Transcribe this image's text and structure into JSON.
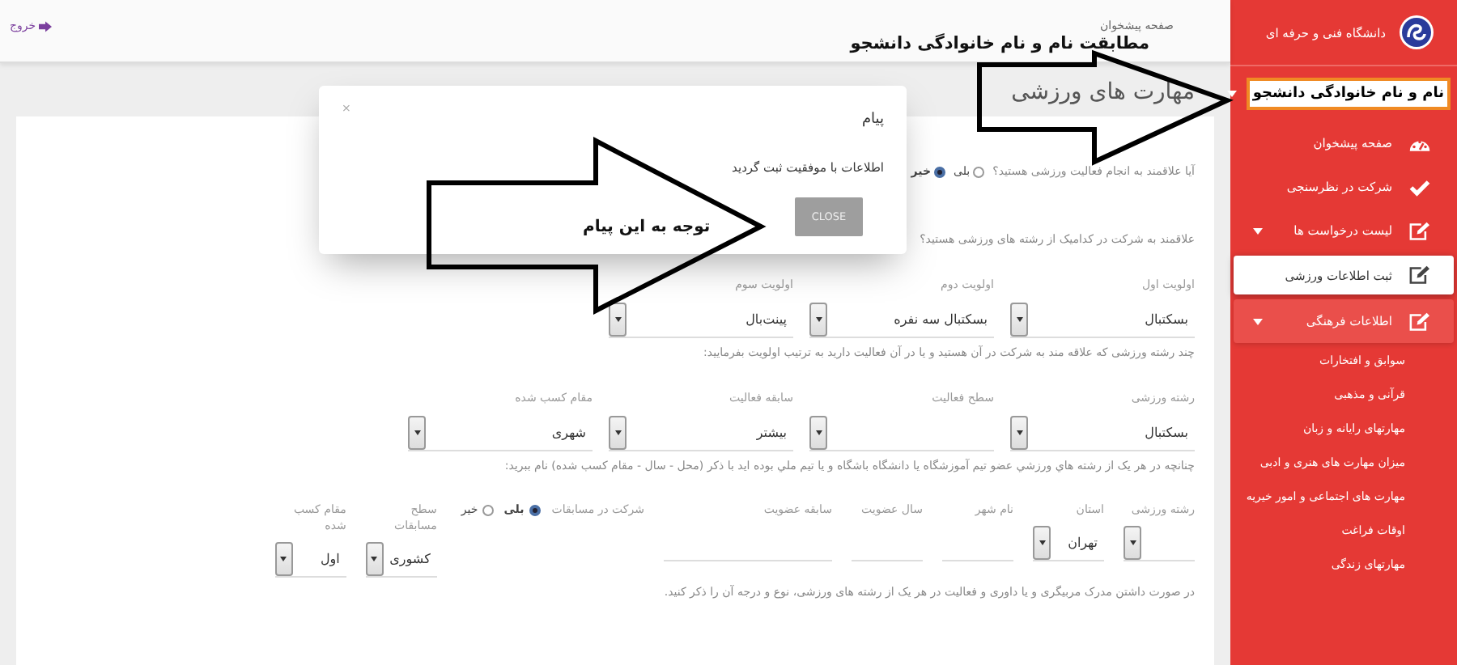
{
  "topbar": {
    "breadcrumb": "صفحه پیشخوان",
    "annotation": "مطابقت نام و نام خانوادگی دانشجو",
    "logout": "خروج"
  },
  "sidebar": {
    "brand": "دانشگاه فنی و حرفه ای",
    "user": {
      "name": "نام و نام خانوادگی دانشجو",
      "highlighted": true
    },
    "items": [
      {
        "label": "صفحه پیشخوان",
        "kind": "gauge",
        "selected": false,
        "highlighted": false
      },
      {
        "label": "شرکت در نظرسنجی",
        "kind": "check",
        "selected": false,
        "highlighted": false
      },
      {
        "label": "لیست درخواست ها",
        "kind": "edit",
        "selected": false,
        "highlighted": false,
        "expanded": true,
        "children": [
          {
            "label": "ثبت اطلاعات ورزشی",
            "kind": "edit",
            "selected": true,
            "highlighted": false
          }
        ]
      },
      {
        "label": "اطلاعات فرهنگی",
        "kind": "edit",
        "selected": false,
        "highlighted": true,
        "expanded": true,
        "children": [
          {
            "label": "سوابق و افتخارات",
            "selected": false,
            "highlighted": false
          },
          {
            "label": "قرآنی و مذهبی",
            "selected": false,
            "highlighted": false
          },
          {
            "label": "مهارتهای رایانه و زبان",
            "selected": false,
            "highlighted": false
          },
          {
            "label": "میزان مهارت های هنری و ادبی",
            "selected": false,
            "highlighted": false
          },
          {
            "label": "مهارت های اجتماعی و امور خیریه",
            "selected": false,
            "highlighted": false
          },
          {
            "label": "اوقات فراغت",
            "selected": false,
            "highlighted": false
          },
          {
            "label": "مهارتهای زندگی",
            "selected": false,
            "highlighted": false
          }
        ]
      }
    ]
  },
  "page": {
    "heading": "مهارت های ورزشی",
    "rows": [
      {
        "kind": "question",
        "text": "آیا علاقمند به انجام فعالیت ورزشی هستید؟",
        "options": [
          {
            "label": "بلی",
            "selected": false
          },
          {
            "label": "خیر",
            "selected": true
          }
        ]
      },
      {
        "kind": "note",
        "text": "علاقمند به شرکت در کدامیک از رشته های ورزشی هستید؟"
      },
      {
        "kind": "fields",
        "fields": [
          {
            "kind": "select",
            "label": "اولویت اول",
            "value": "بسکتبال"
          },
          {
            "kind": "select",
            "label": "اولویت دوم",
            "value": "بسکتبال سه نفره"
          },
          {
            "kind": "select",
            "label": "اولویت سوم",
            "value": "پینت‌بال"
          }
        ]
      },
      {
        "kind": "note",
        "text": "چند رشته ورزشی که علاقه مند به شرکت در آن هستید و یا در آن فعالیت دارید به ترتیب اولویت بفرمایید:"
      },
      {
        "kind": "fields",
        "fields": [
          {
            "kind": "select",
            "label": "رشته ورزشی",
            "value": "بسکتبال"
          },
          {
            "kind": "select",
            "label": "سطح فعالیت"
          },
          {
            "kind": "select",
            "label": "سابقه فعالیت",
            "value": "بیشتر"
          },
          {
            "kind": "select",
            "label": "مقام کسب شده",
            "value": "شهری"
          }
        ]
      },
      {
        "kind": "note",
        "text": "چنانچه در هر یک از رشته هاي ورزشي عضو تيم آموزشگاه يا دانشگاه باشگاه و يا تيم ملي بوده ايد با ذكر (محل - سال - مقام كسب شده) نام ببريد:"
      },
      {
        "kind": "compact",
        "fields": [
          {
            "kind": "select",
            "label": "رشته ورزشی"
          },
          {
            "kind": "select",
            "label": "استان",
            "value": "تهران"
          },
          {
            "kind": "text",
            "label": "نام شهر"
          },
          {
            "kind": "text",
            "label": "سال عضویت"
          },
          {
            "kind": "long-text",
            "label": "سابقه عضویت"
          },
          {
            "kind": "radio",
            "label": "شرکت در مسابقات",
            "options": [
              {
                "label": "بلی",
                "selected": true
              },
              {
                "label": "خیر",
                "selected": false
              }
            ]
          },
          {
            "kind": "select",
            "label": "سطح مسابقات",
            "value": "کشوری"
          },
          {
            "kind": "select",
            "label": "مقام کسب شده",
            "value": "اول"
          }
        ]
      },
      {
        "kind": "note",
        "text": "در صورت داشتن مدرک مربیگری و یا داوری و فعالیت در هر یک از رشته های ورزشی، نوع و درجه آن را ذکر کنید."
      }
    ]
  },
  "modal": {
    "title": "پیام",
    "close": "×",
    "message": "اطلاعات با موفقیت ثبت گردید",
    "button": "CLOSE"
  },
  "callout": {
    "text": "توجه به این پیام"
  }
}
